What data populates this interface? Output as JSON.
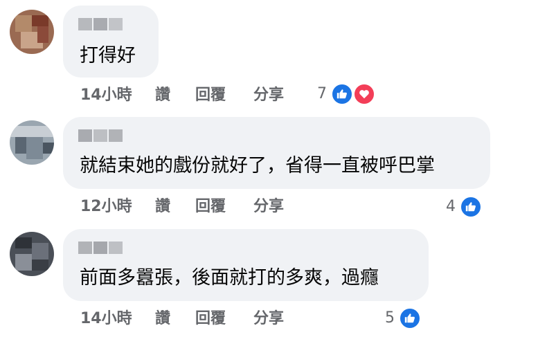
{
  "colors": {
    "bubble_bg": "#f0f2f5",
    "meta_text": "#65676b",
    "like_blue": "#1b74e4",
    "love_red": "#f33e58"
  },
  "comments": [
    {
      "text": "打得好",
      "time": "14小時",
      "like_label": "讚",
      "reply_label": "回覆",
      "share_label": "分享",
      "reaction_count": "7",
      "reaction_icons": [
        "like-icon",
        "love-icon"
      ]
    },
    {
      "text": "就結束她的戲份就好了，省得一直被呼巴掌",
      "time": "12小時",
      "like_label": "讚",
      "reply_label": "回覆",
      "share_label": "分享",
      "reaction_count": "4",
      "reaction_icons": [
        "like-icon"
      ]
    },
    {
      "text": "前面多囂張，後面就打的多爽，過癮",
      "time": "14小時",
      "like_label": "讚",
      "reply_label": "回覆",
      "share_label": "分享",
      "reaction_count": "5",
      "reaction_icons": [
        "like-icon"
      ]
    }
  ]
}
